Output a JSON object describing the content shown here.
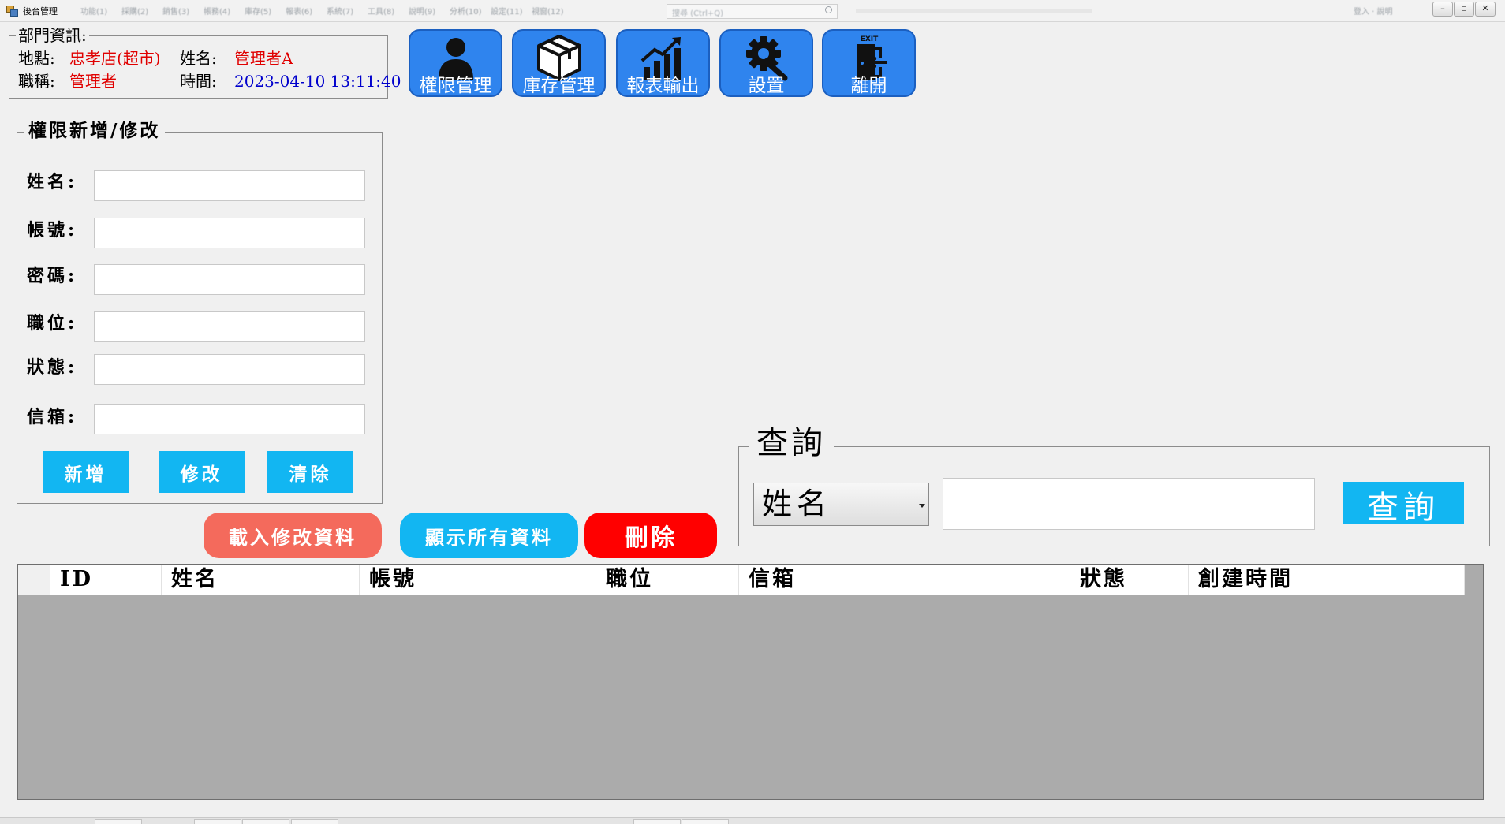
{
  "window": {
    "title": "後台管理",
    "menu_items": [
      "功能(1)",
      "採購(2)",
      "銷售(3)",
      "帳務(4)",
      "庫存(5)",
      "報表(6)",
      "系統(7)",
      "工具(8)",
      "說明(9)",
      "分析(10)",
      "設定(11)",
      "視窗(12)"
    ],
    "search_placeholder": "搜尋 (Ctrl+Q)",
    "account_label": "登入 · 說明",
    "minimize_glyph": "–",
    "restore_glyph": "▫",
    "close_glyph": "✕"
  },
  "department": {
    "legend": "部門資訊:",
    "location_label": "地點:",
    "location_value": "忠孝店(超市)",
    "name_label": "姓名:",
    "name_value": "管理者A",
    "title_label": "職稱:",
    "title_value": "管理者",
    "time_label": "時間:",
    "time_value": "2023-04-10 13:11:40"
  },
  "nav": [
    {
      "label": "權限管理",
      "icon": "user-icon"
    },
    {
      "label": "庫存管理",
      "icon": "box-icon"
    },
    {
      "label": "報表輸出",
      "icon": "chart-icon"
    },
    {
      "label": "設置",
      "icon": "gear-wrench-icon"
    },
    {
      "label": "離開",
      "icon": "exit-door-icon",
      "icon_text": "EXIT"
    }
  ],
  "permission": {
    "legend": "權限新增/修改",
    "fields": [
      {
        "label": "姓名:",
        "value": ""
      },
      {
        "label": "帳號:",
        "value": ""
      },
      {
        "label": "密碼:",
        "value": ""
      },
      {
        "label": "職位:",
        "value": ""
      },
      {
        "label": "狀態:",
        "value": ""
      },
      {
        "label": "信箱:",
        "value": ""
      }
    ],
    "add_label": "新增",
    "edit_label": "修改",
    "clear_label": "清除"
  },
  "actions": {
    "load_label": "載入修改資料",
    "show_all_label": "顯示所有資料",
    "delete_label": "刪除"
  },
  "query": {
    "legend": "查詢",
    "select_value": "姓名",
    "input_value": "",
    "button_label": "查詢"
  },
  "grid": {
    "columns": [
      "ID",
      "姓名",
      "帳號",
      "職位",
      "信箱",
      "狀態",
      "創建時間"
    ],
    "rows": []
  },
  "colors": {
    "nav_blue": "#2f84ee",
    "cyan": "#12b6f2",
    "salmon": "#f46a5c",
    "delete_red": "#ff0000",
    "grid_bg": "#ababab"
  }
}
